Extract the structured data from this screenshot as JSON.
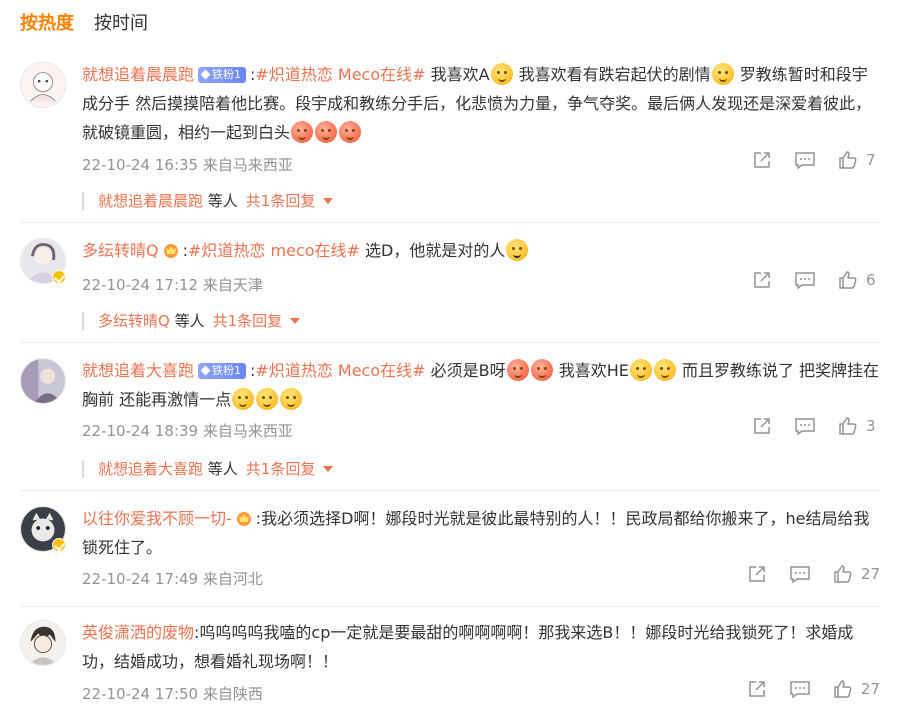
{
  "tabs": [
    {
      "label": "按热度",
      "active": true
    },
    {
      "label": "按时间",
      "active": false
    }
  ],
  "colors": {
    "accent": "#ff8200",
    "link": "#eb7350",
    "muted": "#939393"
  },
  "comments": [
    {
      "author": "就想追着晨晨跑",
      "fan_badge": "铁粉1",
      "body_pre": ":",
      "tag": "#炽道热恋 Meco在线#",
      "body": " 我喜欢A",
      "body2": " 我喜欢看有跌宕起伏的剧情",
      "body3": " 罗教练暂时和段宇成分手 然后摸摸陪着他比赛。段宇成和教练分手后，化悲愤为力量，争气夺奖。最后俩人发现还是深爱着彼此，就破镜重圆，相约一起到白头",
      "meta": "22-10-24 16:35 来自马来西亚",
      "likes": "7",
      "reply_author": "就想追着晨晨跑",
      "reply_others": " 等人",
      "reply_link": "共1条回复"
    },
    {
      "author": "多纭转晴Q",
      "body_pre": ":",
      "tag": "#炽道热恋 meco在线#",
      "body": " 选D，他就是对的人",
      "meta": "22-10-24 17:12 来自天津",
      "likes": "6",
      "reply_author": "多纭转晴Q",
      "reply_others": " 等人",
      "reply_link": "共1条回复"
    },
    {
      "author": "就想追着大喜跑",
      "fan_badge": "铁粉1",
      "body_pre": ":",
      "tag": "#炽道热恋 Meco在线#",
      "body": " 必须是B呀",
      "body2": " 我喜欢HE",
      "body3": " 而且罗教练说了 把奖牌挂在胸前 还能再激情一点",
      "meta": "22-10-24 18:39 来自马来西亚",
      "likes": "3",
      "reply_author": "就想追着大喜跑",
      "reply_others": " 等人",
      "reply_link": "共1条回复"
    },
    {
      "author": "以往你爱我不顾一切-",
      "body": ":我必须选择D啊！娜段时光就是彼此最特别的人！！民政局都给你搬来了，he结局给我锁死住了。",
      "meta": "22-10-24 17:49 来自河北",
      "likes": "27"
    },
    {
      "author": "英俊潇洒的废物",
      "body": ":呜呜呜呜我嗑的cp一定就是要最甜的啊啊啊啊！那我来选B！！娜段时光给我锁死了！求婚成功，结婚成功，想看婚礼现场啊！！",
      "meta": "22-10-24 17:50 来自陕西",
      "likes": "27"
    }
  ]
}
